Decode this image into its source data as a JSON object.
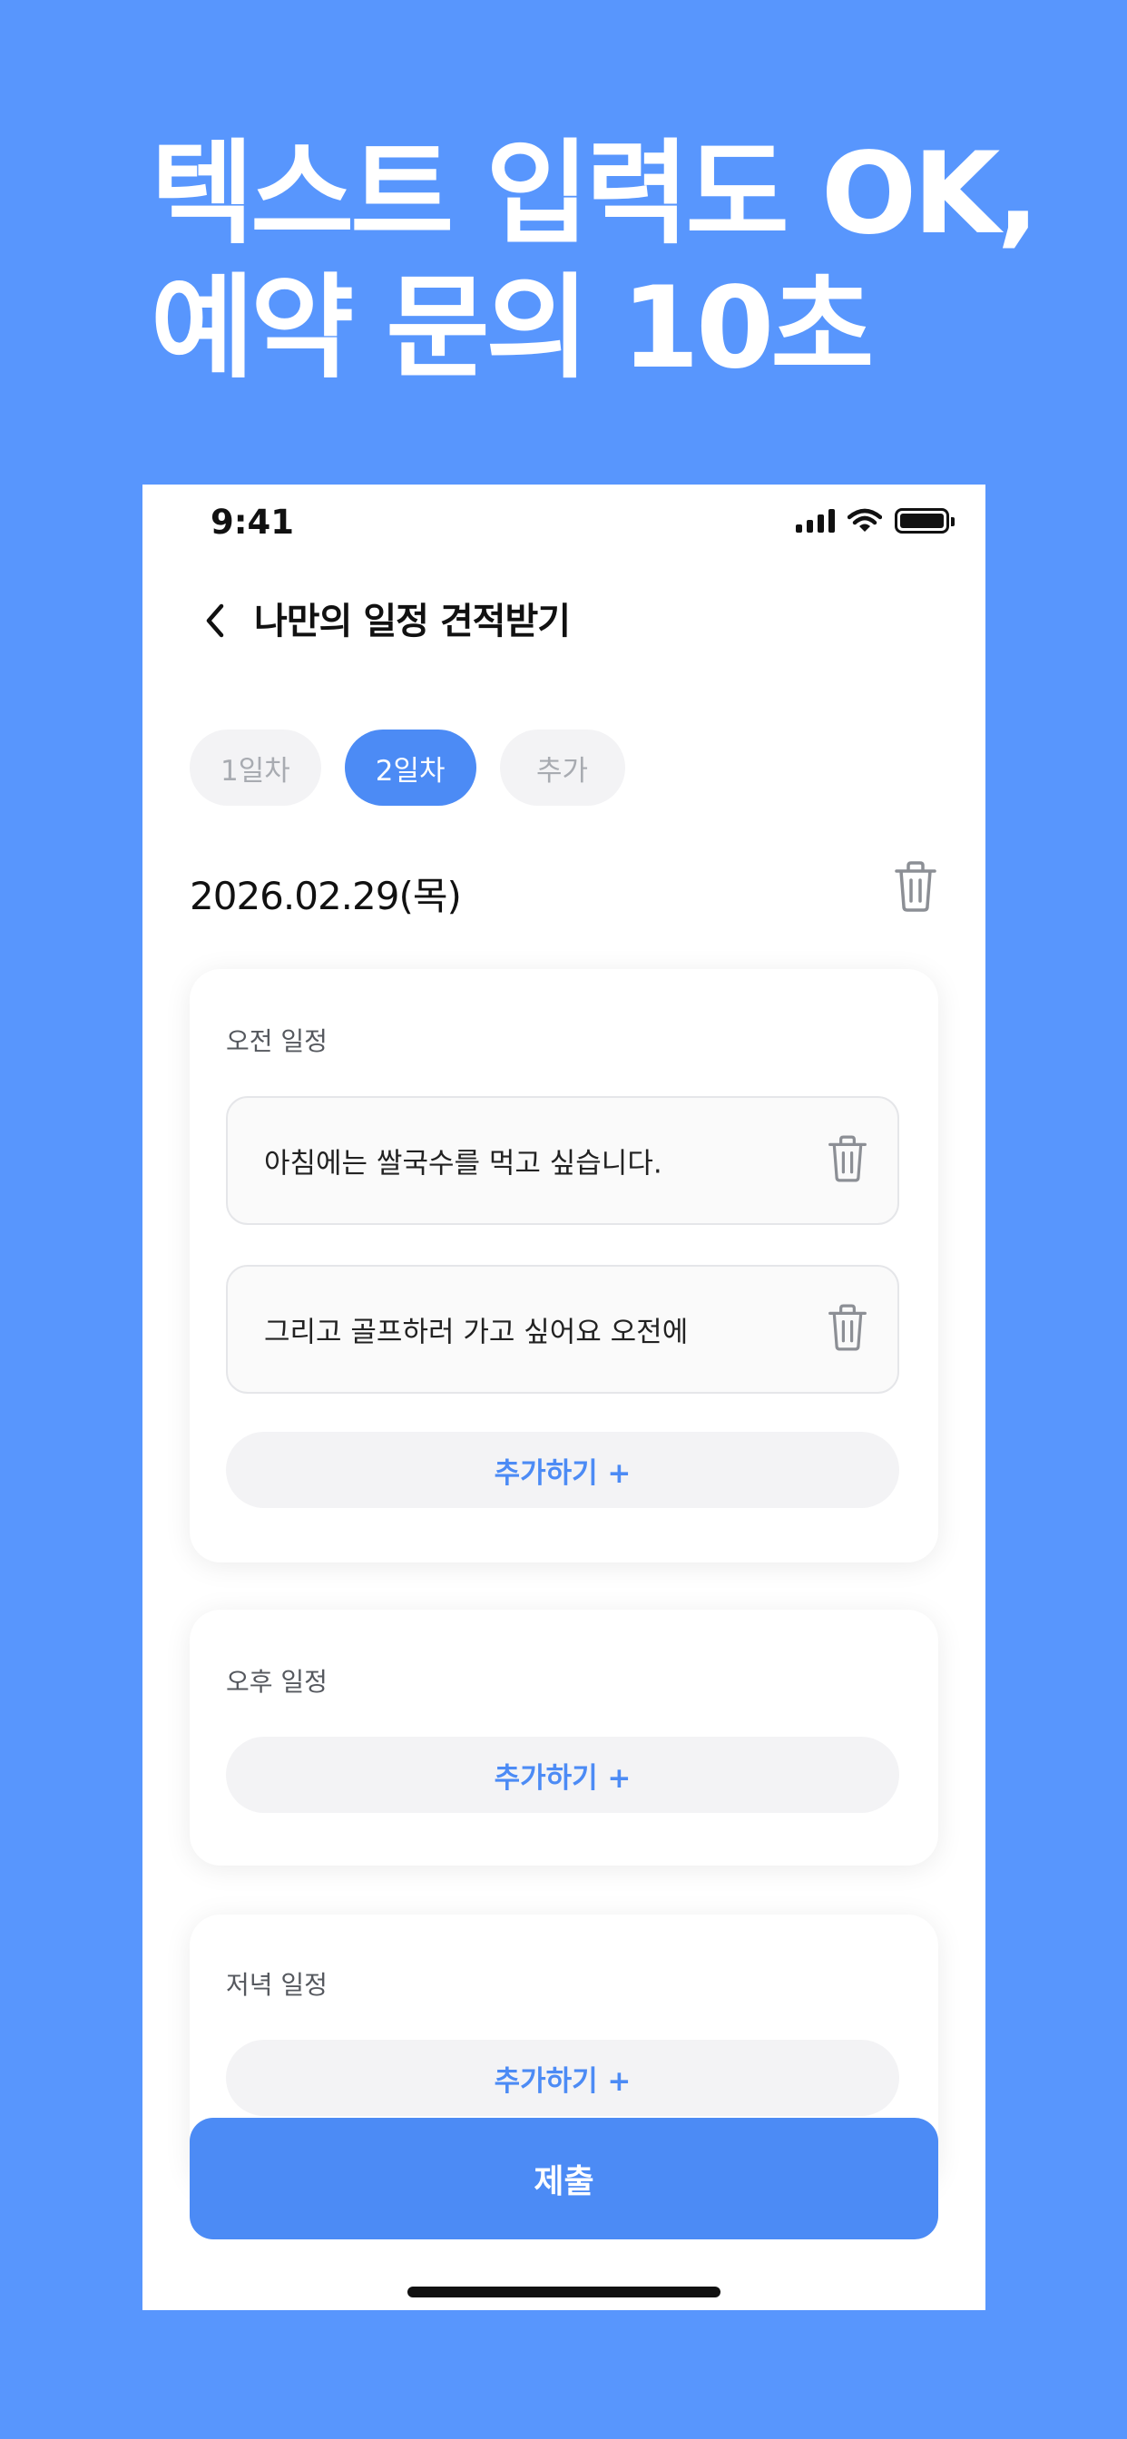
{
  "headline": {
    "line1": "텍스트 입력도 OK,",
    "line2": "예약 문의 10초"
  },
  "status_bar": {
    "time": "9:41"
  },
  "nav": {
    "title": "나만의 일정 견적받기",
    "back_icon": "chevron-left-icon"
  },
  "day_tabs": [
    {
      "label": "1일차",
      "active": false
    },
    {
      "label": "2일차",
      "active": true
    },
    {
      "label": "추가",
      "active": false
    }
  ],
  "date": "2026.02.29(목)",
  "sections": {
    "morning": {
      "label": "오전 일정",
      "entries": [
        "아침에는 쌀국수를 먹고 싶습니다.",
        "그리고 골프하러 가고 싶어요 오전에"
      ],
      "add_label": "추가하기 +"
    },
    "afternoon": {
      "label": "오후 일정",
      "add_label": "추가하기 +"
    },
    "evening": {
      "label": "저녁 일정",
      "add_label": "추가하기 +"
    }
  },
  "submit_label": "제출",
  "colors": {
    "background": "#5896fd",
    "accent": "#4c8bf5",
    "chip_inactive": "#f3f3f5"
  }
}
